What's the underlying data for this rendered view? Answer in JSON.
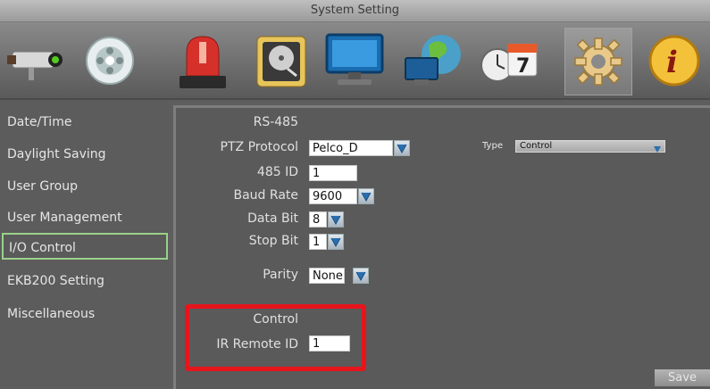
{
  "window": {
    "title": "System Setting"
  },
  "toolbar": {
    "icons": [
      {
        "name": "camera-icon"
      },
      {
        "name": "record-reel-icon"
      },
      {
        "name": "alarm-siren-icon"
      },
      {
        "name": "hard-disk-icon"
      },
      {
        "name": "monitor-icon"
      },
      {
        "name": "network-globe-icon"
      },
      {
        "name": "schedule-clock-icon",
        "badge": "7"
      },
      {
        "name": "gear-icon",
        "selected": true
      },
      {
        "name": "info-icon",
        "glyph": "i"
      }
    ]
  },
  "sidebar": {
    "items": [
      {
        "label": "Date/Time"
      },
      {
        "label": "Daylight Saving"
      },
      {
        "label": "User Group"
      },
      {
        "label": "User Management"
      },
      {
        "label": "I/O Control",
        "selected": true
      },
      {
        "label": "EKB200 Setting"
      },
      {
        "label": "Miscellaneous"
      }
    ]
  },
  "rs485": {
    "header": "RS-485",
    "ptz_protocol": {
      "label": "PTZ Protocol",
      "value": "Pelco_D"
    },
    "id_485": {
      "label": "485 ID",
      "value": "1"
    },
    "baud_rate": {
      "label": "Baud Rate",
      "value": "9600"
    },
    "data_bit": {
      "label": "Data Bit",
      "value": "8"
    },
    "stop_bit": {
      "label": "Stop Bit",
      "value": "1"
    },
    "parity": {
      "label": "Parity",
      "value": "None"
    }
  },
  "type": {
    "label": "Type",
    "value": "Control"
  },
  "control": {
    "header": "Control",
    "ir_remote": {
      "label": "IR Remote ID",
      "value": "1"
    }
  },
  "actions": {
    "save_label": "Save"
  },
  "colors": {
    "highlight_border": "#e8141c",
    "selected_item_border": "#9bd08a"
  }
}
